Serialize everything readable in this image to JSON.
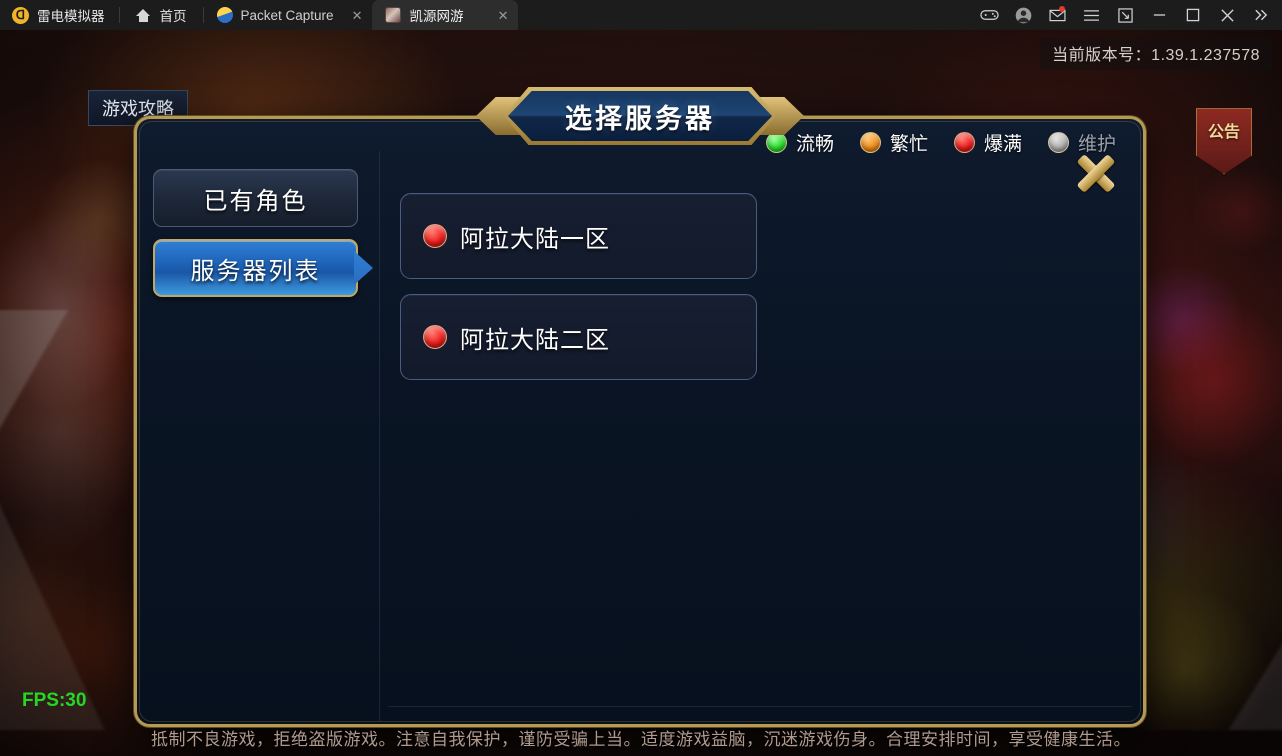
{
  "titlebar": {
    "brand": "雷电模拟器",
    "home_label": "首页",
    "tabs": [
      {
        "label": "Packet Capture",
        "icon": "packet-capture-icon",
        "active": false,
        "close": "✕"
      },
      {
        "label": "凯源网游",
        "icon": "game-icon",
        "active": true,
        "close": "✕"
      }
    ],
    "right_icons": [
      "gamepad-icon",
      "account-avatar-icon",
      "mail-icon",
      "menu-icon",
      "resize-icon",
      "minimize-icon",
      "maximize-icon",
      "close-icon",
      "expand-icon"
    ]
  },
  "game": {
    "version_text": "当前版本号：1.39.1.237578",
    "strategy_button": "游戏攻略",
    "notice_button": "公告",
    "fps": "FPS:30",
    "disclaimer": "抵制不良游戏，拒绝盗版游戏。注意自我保护，谨防受骗上当。适度游戏益脑，沉迷游戏伤身。合理安排时间，享受健康生活。"
  },
  "dialog": {
    "title": "选择服务器",
    "close_label": "关闭",
    "tabs": [
      {
        "label": "已有角色",
        "active": false
      },
      {
        "label": "服务器列表",
        "active": true
      }
    ],
    "legend": [
      {
        "label": "流畅",
        "color": "#2ade2a",
        "state": "smooth"
      },
      {
        "label": "繁忙",
        "color": "#f28c17",
        "state": "busy"
      },
      {
        "label": "爆满",
        "color": "#ee1c1c",
        "state": "full"
      },
      {
        "label": "维护",
        "color": "#b0b0b0",
        "state": "maintenance"
      }
    ],
    "servers": [
      {
        "name": "阿拉大陆一区",
        "status": "full",
        "color": "#ee1c1c"
      },
      {
        "name": "阿拉大陆二区",
        "status": "full",
        "color": "#ee1c1c"
      }
    ]
  }
}
